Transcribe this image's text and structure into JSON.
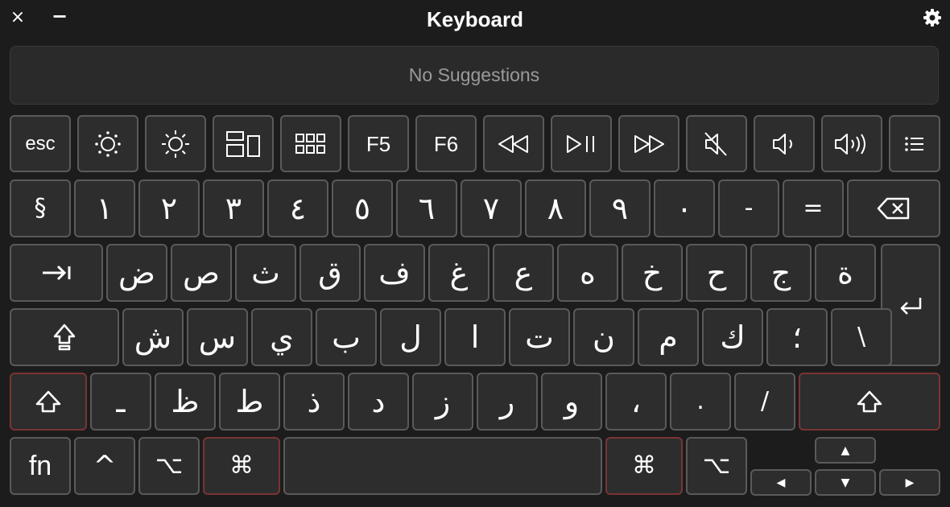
{
  "window": {
    "title": "Keyboard",
    "close_icon": "×",
    "minimize_icon": "−"
  },
  "suggestions": {
    "text": "No Suggestions"
  },
  "function_row": {
    "esc": "esc",
    "f5": "F5",
    "f6": "F6"
  },
  "number_row": [
    "§",
    "١",
    "٢",
    "٣",
    "٤",
    "٥",
    "٦",
    "٧",
    "٨",
    "٩",
    "٠",
    "-",
    "="
  ],
  "row_q": [
    "ض",
    "ص",
    "ث",
    "ق",
    "ف",
    "غ",
    "ع",
    "ه",
    "خ",
    "ح",
    "ج",
    "ة"
  ],
  "row_a": [
    "ش",
    "س",
    "ي",
    "ب",
    "ل",
    "ا",
    "ت",
    "ن",
    "م",
    "ك",
    "؛",
    "\\"
  ],
  "row_z": [
    "ـ",
    "ظ",
    "ط",
    "ذ",
    "د",
    "ز",
    "ر",
    "و",
    "،",
    ".",
    "/"
  ],
  "bottom_row": {
    "fn": "fn",
    "control": "^",
    "option_left": "⌥",
    "command_left": "⌘",
    "command_right": "⌘",
    "option_right": "⌥",
    "arrow_up": "▲",
    "arrow_left": "◀",
    "arrow_down": "▼",
    "arrow_right": "▶"
  },
  "colors": {
    "background": "#1c1c1c",
    "key": "#2d2d2d",
    "key_border": "#5a5a5a",
    "modifier_highlight": "#7a3434"
  }
}
